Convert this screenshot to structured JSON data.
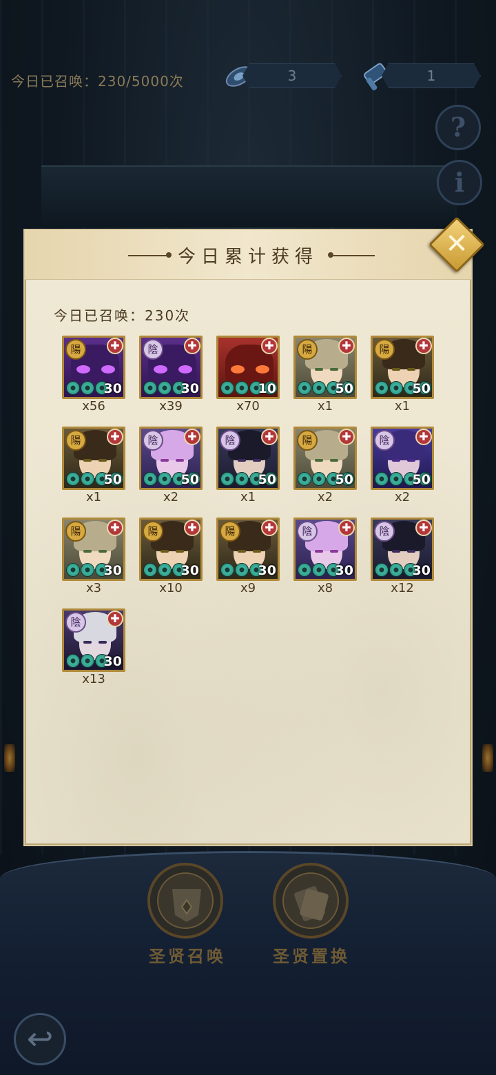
{
  "top_bar": {
    "summon_count_text": "今日已召唤：230/5000次",
    "resource_1": {
      "icon": "scroll-token-icon",
      "value": "3"
    },
    "resource_2": {
      "icon": "scroll-icon",
      "value": "1"
    },
    "help_label": "?",
    "info_label": "i"
  },
  "panel": {
    "title": "今日累计获得",
    "close_label": "✕",
    "today_summoned": "今日已召唤：230次"
  },
  "colors": {
    "panel_bg": "#efe8d4",
    "gold_frame": "#b08a3a",
    "text_brown": "#4b3a22",
    "coin_teal": "#3fb6a2",
    "yang_badge": "#d6a941",
    "yin_badge": "#d8c6e6"
  },
  "cards": [
    {
      "badge": "陽",
      "type": "mask-purple",
      "coins": 3,
      "level": "30",
      "count": "x56"
    },
    {
      "badge": "陰",
      "type": "mask-purple",
      "coins": 3,
      "level": "30",
      "count": "x39"
    },
    {
      "badge": "",
      "type": "mask-red",
      "coins": 4,
      "level": "10",
      "count": "x70"
    },
    {
      "badge": "陽",
      "type": "hero-light",
      "coins": 4,
      "level": "50",
      "count": "x1"
    },
    {
      "badge": "陽",
      "type": "hero-brown",
      "coins": 4,
      "level": "50",
      "count": "x1"
    },
    {
      "badge": "陽",
      "type": "hero-brown",
      "coins": 4,
      "level": "50",
      "count": "x1"
    },
    {
      "badge": "陰",
      "type": "hero-pink",
      "coins": 4,
      "level": "50",
      "count": "x2"
    },
    {
      "badge": "陰",
      "type": "hero-dark",
      "coins": 4,
      "level": "50",
      "count": "x1"
    },
    {
      "badge": "陽",
      "type": "hero-light",
      "coins": 4,
      "level": "50",
      "count": "x2"
    },
    {
      "badge": "陰",
      "type": "hero-violet",
      "coins": 4,
      "level": "50",
      "count": "x2"
    },
    {
      "badge": "陽",
      "type": "hero-light",
      "coins": 3,
      "level": "30",
      "count": "x3"
    },
    {
      "badge": "陽",
      "type": "hero-brown",
      "coins": 3,
      "level": "30",
      "count": "x10"
    },
    {
      "badge": "陽",
      "type": "hero-brown",
      "coins": 3,
      "level": "30",
      "count": "x9"
    },
    {
      "badge": "陰",
      "type": "hero-pink",
      "coins": 3,
      "level": "30",
      "count": "x8"
    },
    {
      "badge": "陰",
      "type": "hero-dark",
      "coins": 3,
      "level": "30",
      "count": "x12"
    },
    {
      "badge": "陰",
      "type": "hero-silver",
      "coins": 3,
      "level": "30",
      "count": "x13"
    }
  ],
  "bottom_nav": {
    "summon_label": "圣贤召唤",
    "exchange_label": "圣贤置换",
    "back_icon": "back-arrow-icon"
  }
}
